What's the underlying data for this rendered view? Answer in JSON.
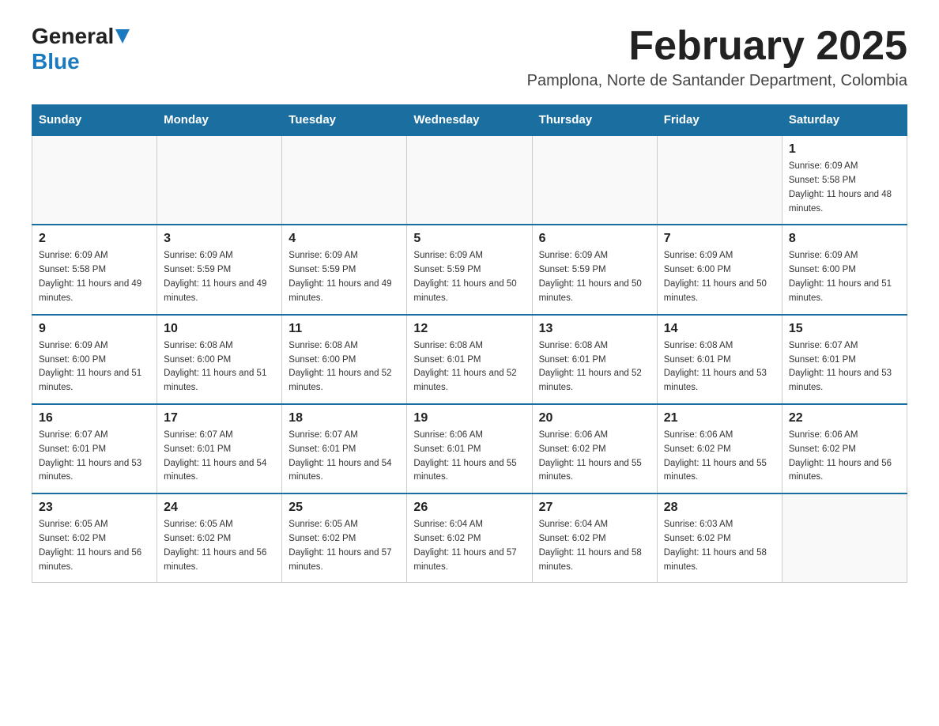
{
  "header": {
    "logo_general": "General",
    "logo_blue": "Blue",
    "month_title": "February 2025",
    "subtitle": "Pamplona, Norte de Santander Department, Colombia"
  },
  "weekdays": [
    "Sunday",
    "Monday",
    "Tuesday",
    "Wednesday",
    "Thursday",
    "Friday",
    "Saturday"
  ],
  "weeks": [
    [
      {
        "day": "",
        "sunrise": "",
        "sunset": "",
        "daylight": ""
      },
      {
        "day": "",
        "sunrise": "",
        "sunset": "",
        "daylight": ""
      },
      {
        "day": "",
        "sunrise": "",
        "sunset": "",
        "daylight": ""
      },
      {
        "day": "",
        "sunrise": "",
        "sunset": "",
        "daylight": ""
      },
      {
        "day": "",
        "sunrise": "",
        "sunset": "",
        "daylight": ""
      },
      {
        "day": "",
        "sunrise": "",
        "sunset": "",
        "daylight": ""
      },
      {
        "day": "1",
        "sunrise": "Sunrise: 6:09 AM",
        "sunset": "Sunset: 5:58 PM",
        "daylight": "Daylight: 11 hours and 48 minutes."
      }
    ],
    [
      {
        "day": "2",
        "sunrise": "Sunrise: 6:09 AM",
        "sunset": "Sunset: 5:58 PM",
        "daylight": "Daylight: 11 hours and 49 minutes."
      },
      {
        "day": "3",
        "sunrise": "Sunrise: 6:09 AM",
        "sunset": "Sunset: 5:59 PM",
        "daylight": "Daylight: 11 hours and 49 minutes."
      },
      {
        "day": "4",
        "sunrise": "Sunrise: 6:09 AM",
        "sunset": "Sunset: 5:59 PM",
        "daylight": "Daylight: 11 hours and 49 minutes."
      },
      {
        "day": "5",
        "sunrise": "Sunrise: 6:09 AM",
        "sunset": "Sunset: 5:59 PM",
        "daylight": "Daylight: 11 hours and 50 minutes."
      },
      {
        "day": "6",
        "sunrise": "Sunrise: 6:09 AM",
        "sunset": "Sunset: 5:59 PM",
        "daylight": "Daylight: 11 hours and 50 minutes."
      },
      {
        "day": "7",
        "sunrise": "Sunrise: 6:09 AM",
        "sunset": "Sunset: 6:00 PM",
        "daylight": "Daylight: 11 hours and 50 minutes."
      },
      {
        "day": "8",
        "sunrise": "Sunrise: 6:09 AM",
        "sunset": "Sunset: 6:00 PM",
        "daylight": "Daylight: 11 hours and 51 minutes."
      }
    ],
    [
      {
        "day": "9",
        "sunrise": "Sunrise: 6:09 AM",
        "sunset": "Sunset: 6:00 PM",
        "daylight": "Daylight: 11 hours and 51 minutes."
      },
      {
        "day": "10",
        "sunrise": "Sunrise: 6:08 AM",
        "sunset": "Sunset: 6:00 PM",
        "daylight": "Daylight: 11 hours and 51 minutes."
      },
      {
        "day": "11",
        "sunrise": "Sunrise: 6:08 AM",
        "sunset": "Sunset: 6:00 PM",
        "daylight": "Daylight: 11 hours and 52 minutes."
      },
      {
        "day": "12",
        "sunrise": "Sunrise: 6:08 AM",
        "sunset": "Sunset: 6:01 PM",
        "daylight": "Daylight: 11 hours and 52 minutes."
      },
      {
        "day": "13",
        "sunrise": "Sunrise: 6:08 AM",
        "sunset": "Sunset: 6:01 PM",
        "daylight": "Daylight: 11 hours and 52 minutes."
      },
      {
        "day": "14",
        "sunrise": "Sunrise: 6:08 AM",
        "sunset": "Sunset: 6:01 PM",
        "daylight": "Daylight: 11 hours and 53 minutes."
      },
      {
        "day": "15",
        "sunrise": "Sunrise: 6:07 AM",
        "sunset": "Sunset: 6:01 PM",
        "daylight": "Daylight: 11 hours and 53 minutes."
      }
    ],
    [
      {
        "day": "16",
        "sunrise": "Sunrise: 6:07 AM",
        "sunset": "Sunset: 6:01 PM",
        "daylight": "Daylight: 11 hours and 53 minutes."
      },
      {
        "day": "17",
        "sunrise": "Sunrise: 6:07 AM",
        "sunset": "Sunset: 6:01 PM",
        "daylight": "Daylight: 11 hours and 54 minutes."
      },
      {
        "day": "18",
        "sunrise": "Sunrise: 6:07 AM",
        "sunset": "Sunset: 6:01 PM",
        "daylight": "Daylight: 11 hours and 54 minutes."
      },
      {
        "day": "19",
        "sunrise": "Sunrise: 6:06 AM",
        "sunset": "Sunset: 6:01 PM",
        "daylight": "Daylight: 11 hours and 55 minutes."
      },
      {
        "day": "20",
        "sunrise": "Sunrise: 6:06 AM",
        "sunset": "Sunset: 6:02 PM",
        "daylight": "Daylight: 11 hours and 55 minutes."
      },
      {
        "day": "21",
        "sunrise": "Sunrise: 6:06 AM",
        "sunset": "Sunset: 6:02 PM",
        "daylight": "Daylight: 11 hours and 55 minutes."
      },
      {
        "day": "22",
        "sunrise": "Sunrise: 6:06 AM",
        "sunset": "Sunset: 6:02 PM",
        "daylight": "Daylight: 11 hours and 56 minutes."
      }
    ],
    [
      {
        "day": "23",
        "sunrise": "Sunrise: 6:05 AM",
        "sunset": "Sunset: 6:02 PM",
        "daylight": "Daylight: 11 hours and 56 minutes."
      },
      {
        "day": "24",
        "sunrise": "Sunrise: 6:05 AM",
        "sunset": "Sunset: 6:02 PM",
        "daylight": "Daylight: 11 hours and 56 minutes."
      },
      {
        "day": "25",
        "sunrise": "Sunrise: 6:05 AM",
        "sunset": "Sunset: 6:02 PM",
        "daylight": "Daylight: 11 hours and 57 minutes."
      },
      {
        "day": "26",
        "sunrise": "Sunrise: 6:04 AM",
        "sunset": "Sunset: 6:02 PM",
        "daylight": "Daylight: 11 hours and 57 minutes."
      },
      {
        "day": "27",
        "sunrise": "Sunrise: 6:04 AM",
        "sunset": "Sunset: 6:02 PM",
        "daylight": "Daylight: 11 hours and 58 minutes."
      },
      {
        "day": "28",
        "sunrise": "Sunrise: 6:03 AM",
        "sunset": "Sunset: 6:02 PM",
        "daylight": "Daylight: 11 hours and 58 minutes."
      },
      {
        "day": "",
        "sunrise": "",
        "sunset": "",
        "daylight": ""
      }
    ]
  ]
}
